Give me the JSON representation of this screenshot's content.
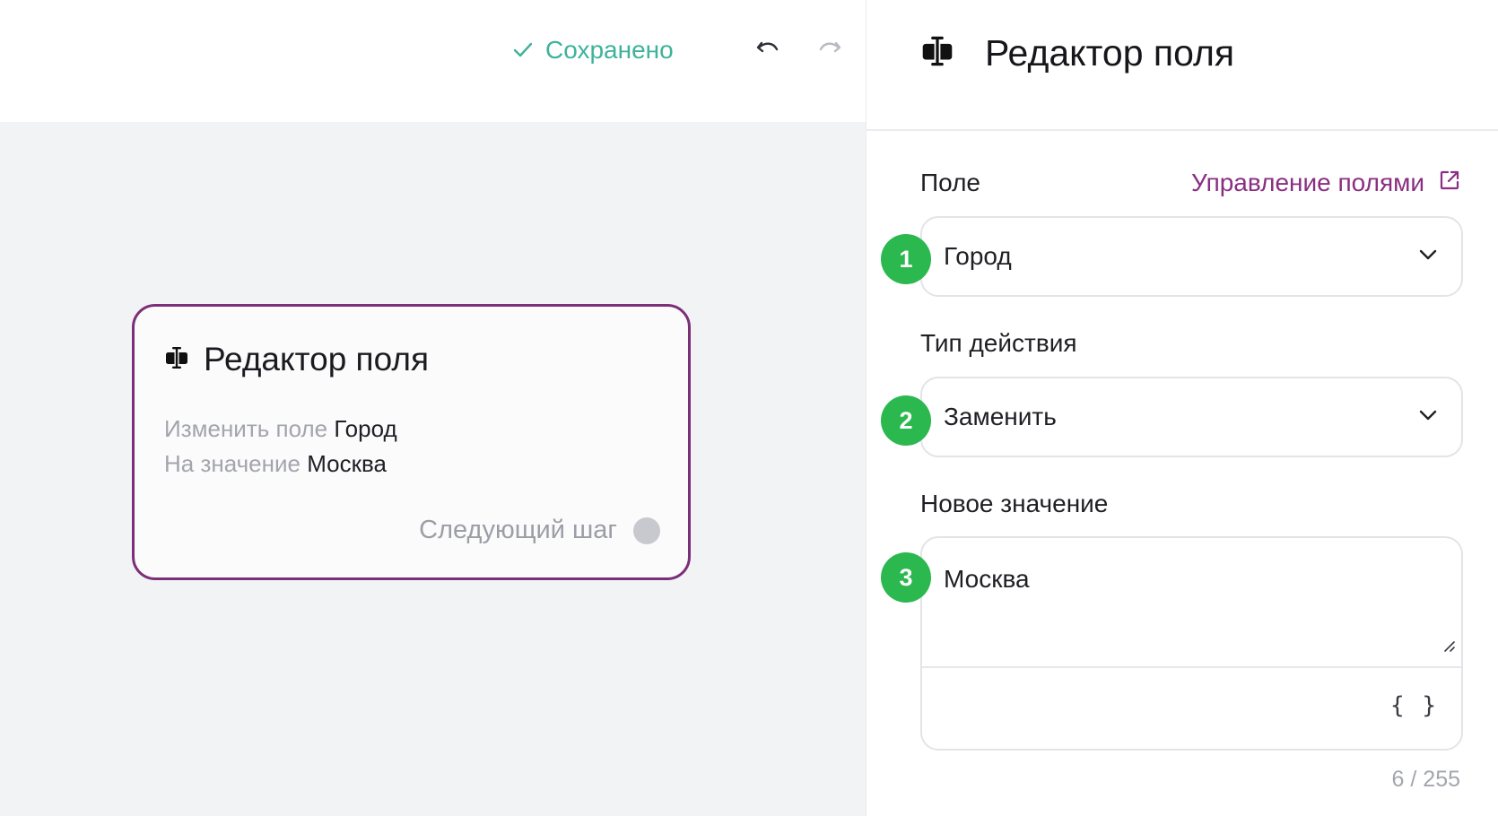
{
  "toolbar": {
    "saved_status": "Сохранено",
    "undo_icon": "undo-icon",
    "redo_icon": "redo-icon"
  },
  "node": {
    "icon": "field-editor-icon",
    "title": "Редактор поля",
    "change_field_label": "Изменить поле",
    "change_field_value": "Город",
    "to_value_label": "На значение",
    "to_value_value": "Москва",
    "next_step_label": "Следующий шаг"
  },
  "panel": {
    "icon": "field-editor-icon",
    "title": "Редактор поля",
    "field_label": "Поле",
    "manage_fields_link": "Управление полями",
    "field_select_value": "Город",
    "action_type_label": "Тип действия",
    "action_select_value": "Заменить",
    "new_value_label": "Новое значение",
    "new_value_text": "Москва",
    "variables_button": "{ }",
    "char_counter": "6 / 255"
  },
  "badges": [
    "1",
    "2",
    "3"
  ],
  "colors": {
    "accent_purple": "#8a2e82",
    "card_border": "#7b2f78",
    "saved_green": "#3eb39a",
    "badge_green": "#2bb84f",
    "canvas_bg": "#f2f3f5"
  }
}
